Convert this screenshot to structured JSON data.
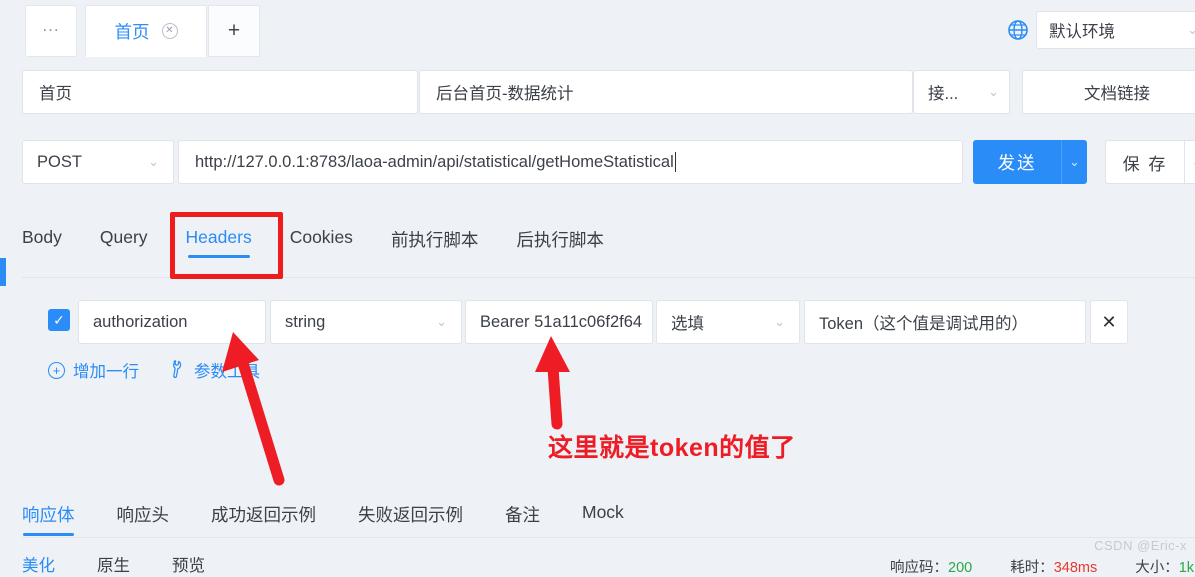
{
  "window": {
    "tabs": [
      {
        "label": "...",
        "name": "overflow-tab"
      },
      {
        "label": "首页",
        "name": "home-tab",
        "active": true,
        "closable": true
      },
      {
        "label": "+",
        "name": "new-tab"
      }
    ],
    "environment": {
      "label": "默认环境",
      "icon": "globe-icon",
      "caret": "⌄"
    }
  },
  "meta_row": {
    "api_name": "首页",
    "api_title": "后台首页-数据统计",
    "group": "接...",
    "doc_link": "文档链接",
    "caret": "⌄"
  },
  "request": {
    "method": "POST",
    "method_caret": "⌄",
    "url": "http://127.0.0.1:8783/laoa-admin/api/statistical/getHomeStatistical",
    "send_label": "发送",
    "send_caret": "⌄",
    "save_label": "保 存",
    "save_caret": "⌄"
  },
  "request_tabs": [
    {
      "label": "Body",
      "active": false
    },
    {
      "label": "Query",
      "active": false
    },
    {
      "label": "Headers",
      "active": true
    },
    {
      "label": "Cookies",
      "active": false
    },
    {
      "label": "前执行脚本",
      "active": false
    },
    {
      "label": "后执行脚本",
      "active": false
    }
  ],
  "headers_table": {
    "rows": [
      {
        "enabled": true,
        "key": "authorization",
        "type": "string",
        "value": "Bearer 51a11c06f2f64",
        "required": "选填",
        "description": "Token（这个值是调试用的）",
        "delete_label": "✕"
      }
    ],
    "add_row_label": "增加一行",
    "add_row_icon": "plus-circle-icon",
    "param_tool_label": "参数工具",
    "param_tool_icon": "wrench-icon",
    "caret": "⌄"
  },
  "response_tabs": [
    {
      "label": "响应体",
      "active": true
    },
    {
      "label": "响应头",
      "active": false
    },
    {
      "label": "成功返回示例",
      "active": false
    },
    {
      "label": "失败返回示例",
      "active": false
    },
    {
      "label": "备注",
      "active": false
    },
    {
      "label": "Mock",
      "active": false
    }
  ],
  "response_subtabs": [
    {
      "label": "美化",
      "active": true
    },
    {
      "label": "原生",
      "active": false
    },
    {
      "label": "预览",
      "active": false
    }
  ],
  "status_bar": {
    "code_label": "响应码：",
    "code_value": "200",
    "time_label": "耗时：",
    "time_value": "348ms",
    "size_label": "大小：",
    "size_value": "1k"
  },
  "watermark": "CSDN @Eric-x",
  "annotations": {
    "callout_text": "这里就是token的值了",
    "highlight_color": "#ee1c1c",
    "arrow_color": "#ee1c25"
  },
  "colors": {
    "accent": "#2a8cf6",
    "background": "#eef1f6",
    "panel": "#ffffff",
    "border": "#dfe3ea",
    "text": "#3c4149",
    "status_ok": "#2aa84a",
    "status_warn": "#e8392f"
  }
}
